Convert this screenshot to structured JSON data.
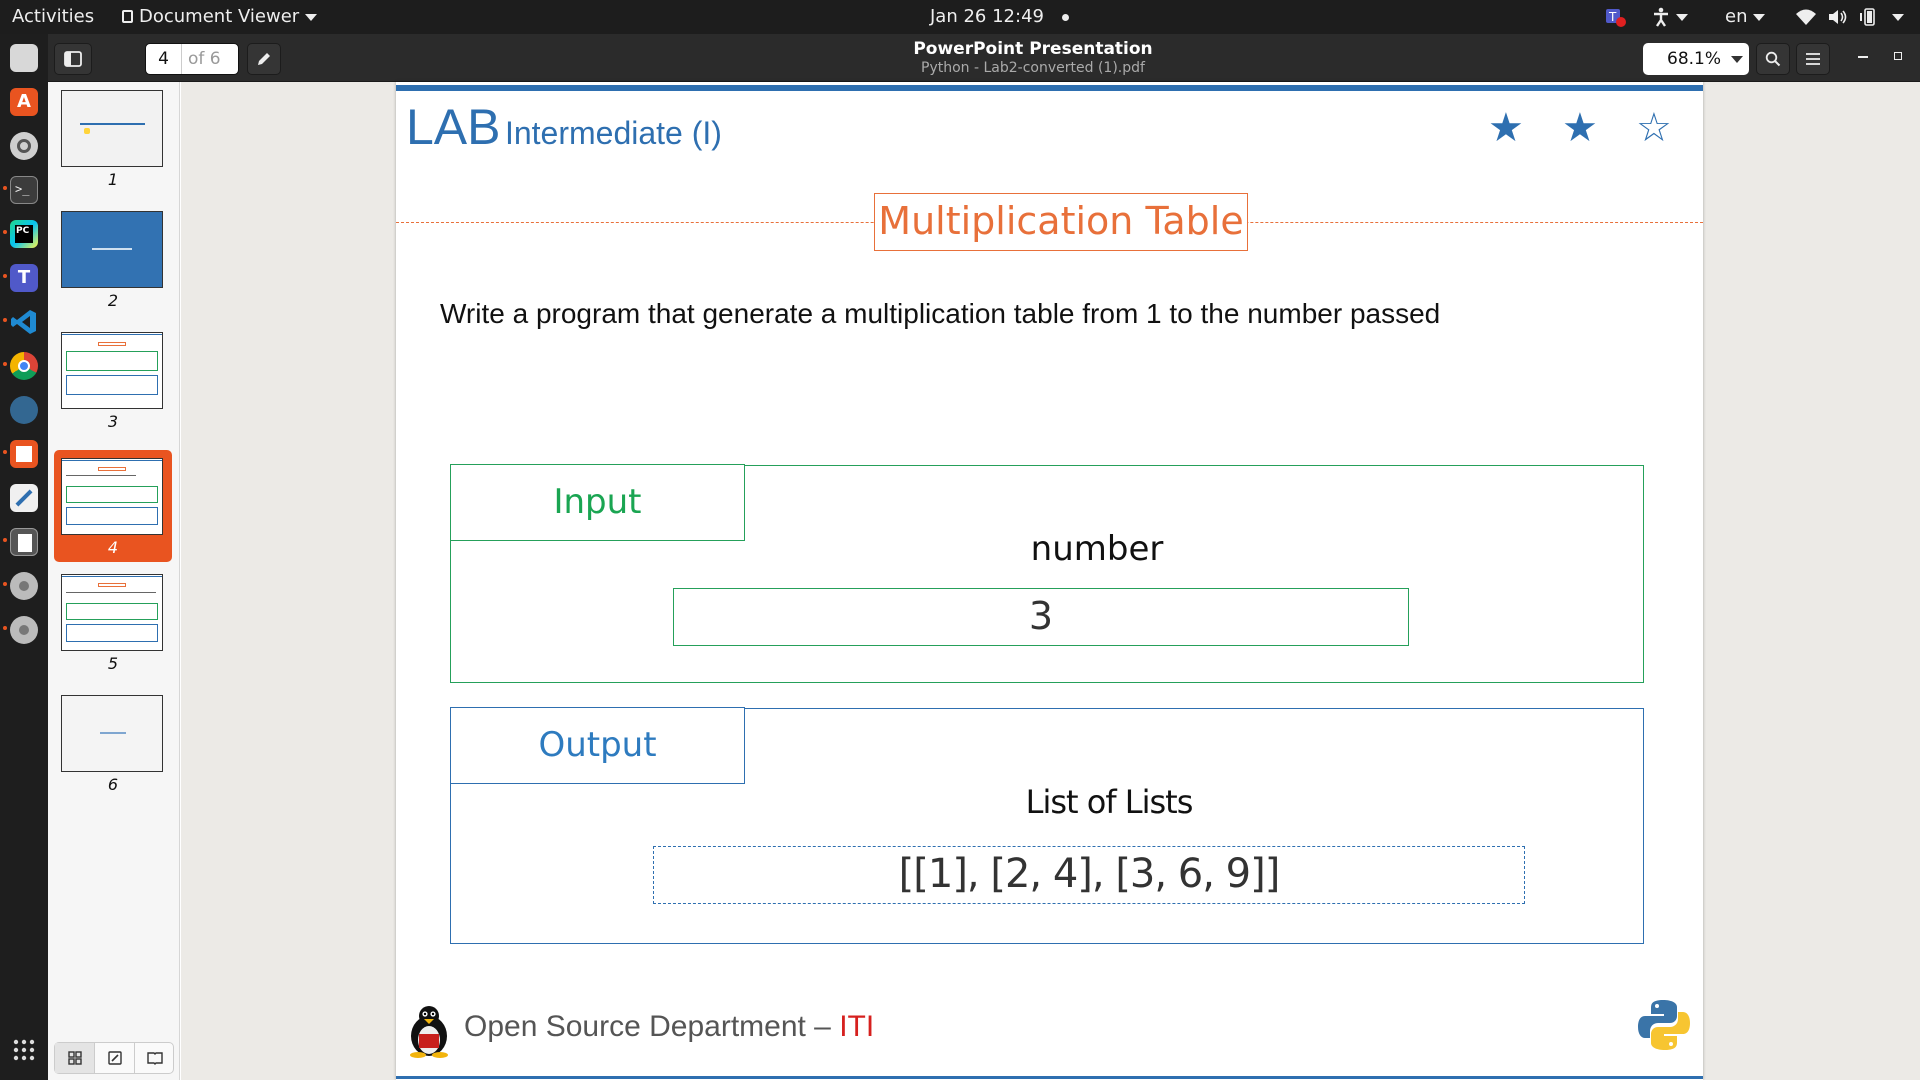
{
  "topbar": {
    "activities": "Activities",
    "app_menu": "Document Viewer",
    "clock": "Jan 26  12:49",
    "language": "en"
  },
  "header": {
    "title": "PowerPoint Presentation",
    "subtitle": "Python - Lab2-converted (1).pdf",
    "current_page": "4",
    "page_total": "of 6",
    "zoom": "68.1%"
  },
  "sidebar": {
    "thumbnails": [
      {
        "num": "1"
      },
      {
        "num": "2"
      },
      {
        "num": "3"
      },
      {
        "num": "4",
        "active": true
      },
      {
        "num": "5"
      },
      {
        "num": "6"
      }
    ]
  },
  "slide": {
    "lab": "LAB",
    "level": "Intermediate (I)",
    "stars": "2 of 3 filled",
    "heading": "Multiplication Table",
    "prompt": "Write a program that generate a multiplication table from 1 to the number passed",
    "input_label": "Input",
    "input_field_label": "number",
    "input_value": "3",
    "output_label": "Output",
    "output_field_label": "List of Lists",
    "output_value": "[[1], [2, 4], [3, 6, 9]]",
    "footer_main": "Open Source Department – ",
    "footer_org": "ITI"
  },
  "colors": {
    "ubuntu_orange": "#e95420",
    "slide_blue": "#2e6fb0",
    "slide_orange": "#e8703a",
    "slide_green": "#25a05a"
  }
}
